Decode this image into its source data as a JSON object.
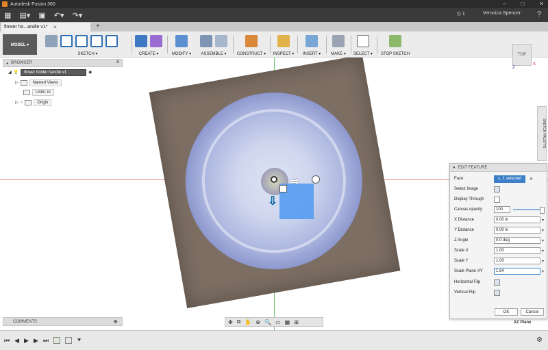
{
  "window": {
    "title": "Autodesk Fusion 360",
    "controls": [
      "–",
      "□",
      "✕"
    ]
  },
  "quick_access": {
    "job_status": "1",
    "user_name": "Veronica Spencer",
    "help": "?"
  },
  "document_tab": {
    "title": "flower ho...andle v1*"
  },
  "ribbon": {
    "workspace": "MODEL ▾",
    "groups": [
      {
        "label": "SKETCH ▾"
      },
      {
        "label": "CREATE ▾"
      },
      {
        "label": "MODIFY ▾"
      },
      {
        "label": "ASSEMBLE ▾"
      },
      {
        "label": "CONSTRUCT ▾"
      },
      {
        "label": "INSPECT ▾"
      },
      {
        "label": "INSERT ▾"
      },
      {
        "label": "MAKE ▾"
      },
      {
        "label": "SELECT ▾"
      },
      {
        "label": "STOP SKETCH"
      }
    ]
  },
  "browser": {
    "title": "BROWSER",
    "items": [
      {
        "label": "flower holder handle v1"
      },
      {
        "label": "Named Views"
      },
      {
        "label": "Units: in"
      },
      {
        "label": "Origin"
      }
    ]
  },
  "viewcube": {
    "face": "TOP",
    "x_axis": "X",
    "z_axis": "Z"
  },
  "sketch_palette": {
    "label": "SKETCH PALETTE"
  },
  "edit_feature": {
    "title": "EDIT FEATURE",
    "face_label": "Face",
    "face_value": "1 selected",
    "select_image": "Select Image",
    "display_through": "Display Through",
    "canvas_opacity_label": "Canvas opacity",
    "canvas_opacity_value": "100",
    "x_distance_label": "X Distance",
    "x_distance_value": "0.00 in",
    "y_distance_label": "Y Distance",
    "y_distance_value": "0.00 in",
    "z_angle_label": "Z Angle",
    "z_angle_value": "0.0 deg",
    "scale_x_label": "Scale X",
    "scale_x_value": "1.00",
    "scale_y_label": "Scale Y",
    "scale_y_value": "1.00",
    "scale_plane_label": "Scale Plane XY",
    "scale_plane_value": "1.64",
    "horizontal_flip": "Horizontal Flip",
    "vertical_flip": "Vertical Flip",
    "ok": "OK",
    "cancel": "Cancel"
  },
  "plane_label": "XZ Plane",
  "comments": {
    "title": "COMMENTS"
  },
  "colors": {
    "accent": "#3c7fc8",
    "image_blue": "#5b9ff0",
    "dark_chrome": "#2b2b2b"
  }
}
